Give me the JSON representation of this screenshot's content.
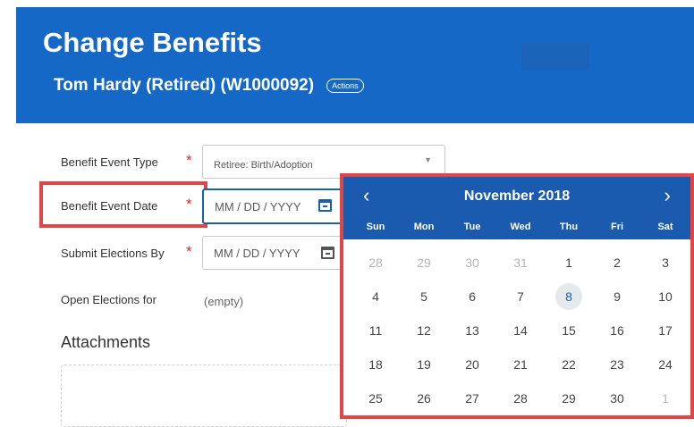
{
  "header": {
    "title": "Change Benefits",
    "subtitle": "Tom Hardy (Retired) (W1000092)",
    "actions_label": "Actions"
  },
  "form": {
    "event_type": {
      "label": "Benefit Event Type",
      "value": "Retiree: Birth/Adoption"
    },
    "event_date": {
      "label": "Benefit Event Date",
      "placeholder": "MM / DD / YYYY"
    },
    "submit_by": {
      "label": "Submit Elections By",
      "placeholder": "MM / DD / YYYY"
    },
    "open_elections": {
      "label": "Open Elections for",
      "value": "(empty)"
    },
    "required_mark": "*",
    "attachments_label": "Attachments"
  },
  "calendar": {
    "month_label": "November 2018",
    "prev_icon": "‹",
    "next_icon": "›",
    "weekdays": [
      "Sun",
      "Mon",
      "Tue",
      "Wed",
      "Thu",
      "Fri",
      "Sat"
    ],
    "days": [
      [
        "28",
        "29",
        "30",
        "31",
        "1",
        "2",
        "3"
      ],
      [
        "4",
        "5",
        "6",
        "7",
        "8",
        "9",
        "10"
      ],
      [
        "11",
        "12",
        "13",
        "14",
        "15",
        "16",
        "17"
      ],
      [
        "18",
        "19",
        "20",
        "21",
        "22",
        "23",
        "24"
      ],
      [
        "25",
        "26",
        "27",
        "28",
        "29",
        "30",
        "1"
      ]
    ],
    "today": "8",
    "highlight_color": "#e04646",
    "header_color": "#1a5bb0"
  }
}
